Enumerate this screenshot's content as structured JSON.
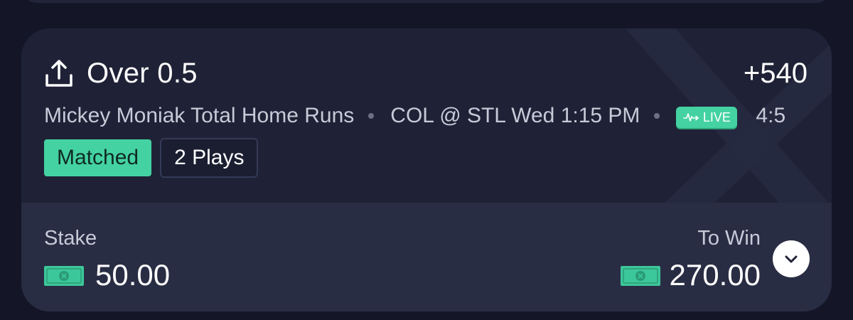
{
  "bet": {
    "title": "Over 0.5",
    "odds": "+540",
    "market": "Mickey Moniak Total Home Runs",
    "game": "COL @ STL Wed 1:15 PM",
    "live_label": "LIVE",
    "count": "4:5",
    "status_tag": "Matched",
    "plays_tag": "2 Plays"
  },
  "wager": {
    "stake_label": "Stake",
    "stake_value": "50.00",
    "towin_label": "To Win",
    "towin_value": "270.00"
  },
  "icons": {
    "share": "share-icon",
    "live": "pulse-icon",
    "currency": "cash-icon",
    "expand": "chevron-down-icon"
  },
  "colors": {
    "background": "#141526",
    "card": "#1f2236",
    "card_bottom": "#292d44",
    "accent": "#44d2a3"
  }
}
